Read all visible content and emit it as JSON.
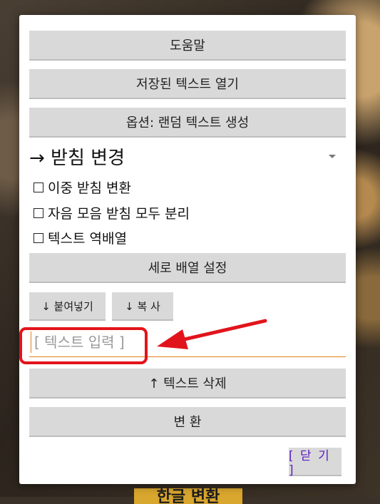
{
  "buttons": {
    "help": "도움말",
    "open_saved": "저장된 텍스트 열기",
    "random_option": "옵션: 랜덤 텍스트 생성",
    "vertical": "세로 배열 설정",
    "paste": "↓ 붙여넣기",
    "copy": "↓ 복 사",
    "delete": "↑ 텍스트 삭제",
    "convert": "변 환",
    "close": "[ 닫 기 ]"
  },
  "select": {
    "value": "→ 받침 변경"
  },
  "checkboxes": [
    {
      "label": "이중 받침 변환",
      "checked": false
    },
    {
      "label": "자음 모음 받침 모두 분리",
      "checked": false
    },
    {
      "label": "텍스트 역배열",
      "checked": false
    }
  ],
  "input": {
    "placeholder": "[ 텍스트 입력 ]",
    "value": ""
  },
  "background": {
    "label": "한글 변환"
  },
  "colors": {
    "accent": "#e2831b",
    "highlight": "#e2141b",
    "close_text": "#5a1ec2"
  }
}
